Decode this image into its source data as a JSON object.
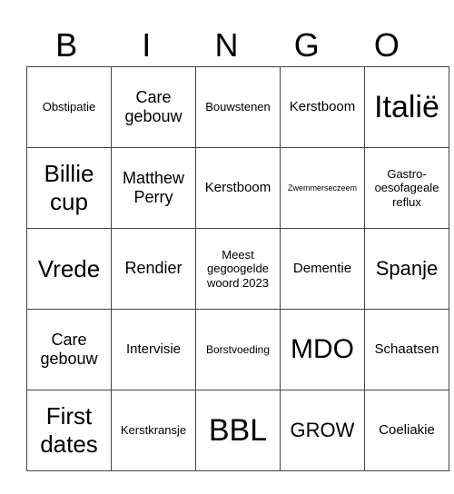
{
  "title_letters": [
    "B",
    "I",
    "N",
    "G",
    "O"
  ],
  "rows": [
    [
      "Obstipatie",
      "Care gebouw",
      "Bouwstenen",
      "Kerstboom",
      "Italië"
    ],
    [
      "Billie cup",
      "Matthew Perry",
      "Kerstboom",
      "Zwemmerseczeem",
      "Gastro-oesofageale reflux"
    ],
    [
      "Vrede",
      "Rendier",
      "Meest gegoogelde woord 2023",
      "Dementie",
      "Spanje"
    ],
    [
      "Care gebouw",
      "Intervisie",
      "Borstvoeding",
      "MDO",
      "Schaatsen"
    ],
    [
      "First dates",
      "Kerstkransje",
      "BBL",
      "GROW",
      "Coeliakie"
    ]
  ]
}
